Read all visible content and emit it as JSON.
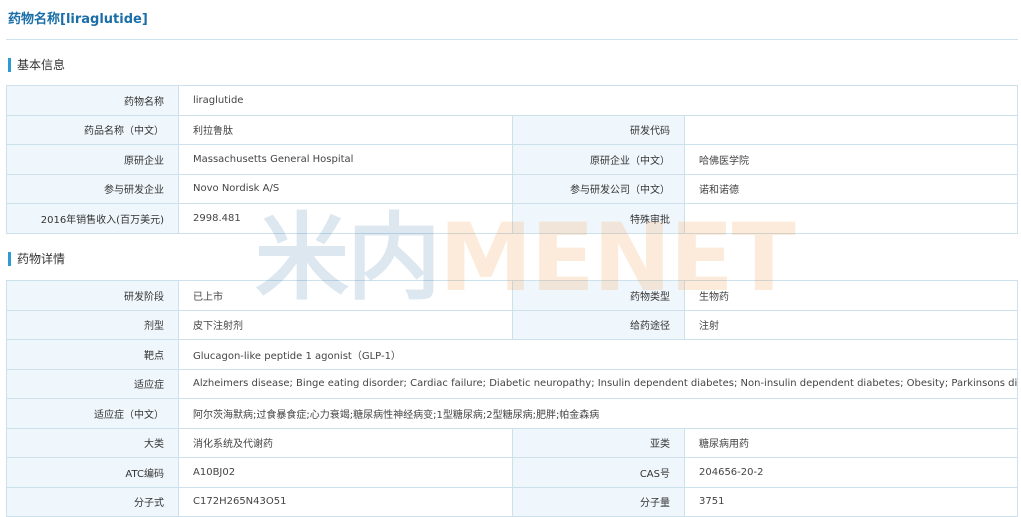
{
  "page_title": "药物名称[liraglutide]",
  "watermark": {
    "part1": "米内",
    "part2": "MENET"
  },
  "colors": {
    "title": "#1b6ea8",
    "accent_bar": "#2f9bd6",
    "label_bg": "#f0f7fc",
    "border": "#cde1ec"
  },
  "basic": {
    "heading": "基本信息",
    "drug_name": {
      "label": "药物名称",
      "value": "liraglutide"
    },
    "product_name": {
      "label": "药品名称（中文）",
      "value": "利拉鲁肽"
    },
    "dev_code": {
      "label": "研发代码",
      "value": ""
    },
    "originator": {
      "label": "原研企业",
      "value": "Massachusetts General Hospital"
    },
    "originator_cn": {
      "label": "原研企业（中文）",
      "value": "哈佛医学院"
    },
    "partner": {
      "label": "参与研发企业",
      "value": "Novo Nordisk A/S"
    },
    "partner_cn": {
      "label": "参与研发公司（中文）",
      "value": "诺和诺德"
    },
    "sales": {
      "label": "2016年销售收入(百万美元)",
      "value": "2998.481"
    },
    "special_review": {
      "label": "特殊审批",
      "value": ""
    }
  },
  "details": {
    "heading": "药物详情",
    "stage": {
      "label": "研发阶段",
      "value": "已上市"
    },
    "drug_type": {
      "label": "药物类型",
      "value": "生物药"
    },
    "dosage_form": {
      "label": "剂型",
      "value": "皮下注射剂"
    },
    "route": {
      "label": "给药途径",
      "value": "注射"
    },
    "target": {
      "label": "靶点",
      "value": "Glucagon-like peptide 1 agonist（GLP-1）"
    },
    "indication": {
      "label": "适应症",
      "value": "Alzheimers disease; Binge eating disorder; Cardiac failure; Diabetic neuropathy; Insulin dependent diabetes; Non-insulin dependent diabetes; Obesity; Parkinsons disease"
    },
    "indication_cn": {
      "label": "适应症（中文）",
      "value": "阿尔茨海默病;过食暴食症;心力衰竭;糖尿病性神经病变;1型糖尿病;2型糖尿病;肥胖;帕金森病"
    },
    "category": {
      "label": "大类",
      "value": "消化系统及代谢药"
    },
    "subcategory": {
      "label": "亚类",
      "value": "糖尿病用药"
    },
    "atc": {
      "label": "ATC编码",
      "value": "A10BJ02"
    },
    "cas": {
      "label": "CAS号",
      "value": "204656-20-2"
    },
    "formula": {
      "label": "分子式",
      "value": "C172H265N43O51"
    },
    "mw": {
      "label": "分子量",
      "value": "3751"
    }
  }
}
